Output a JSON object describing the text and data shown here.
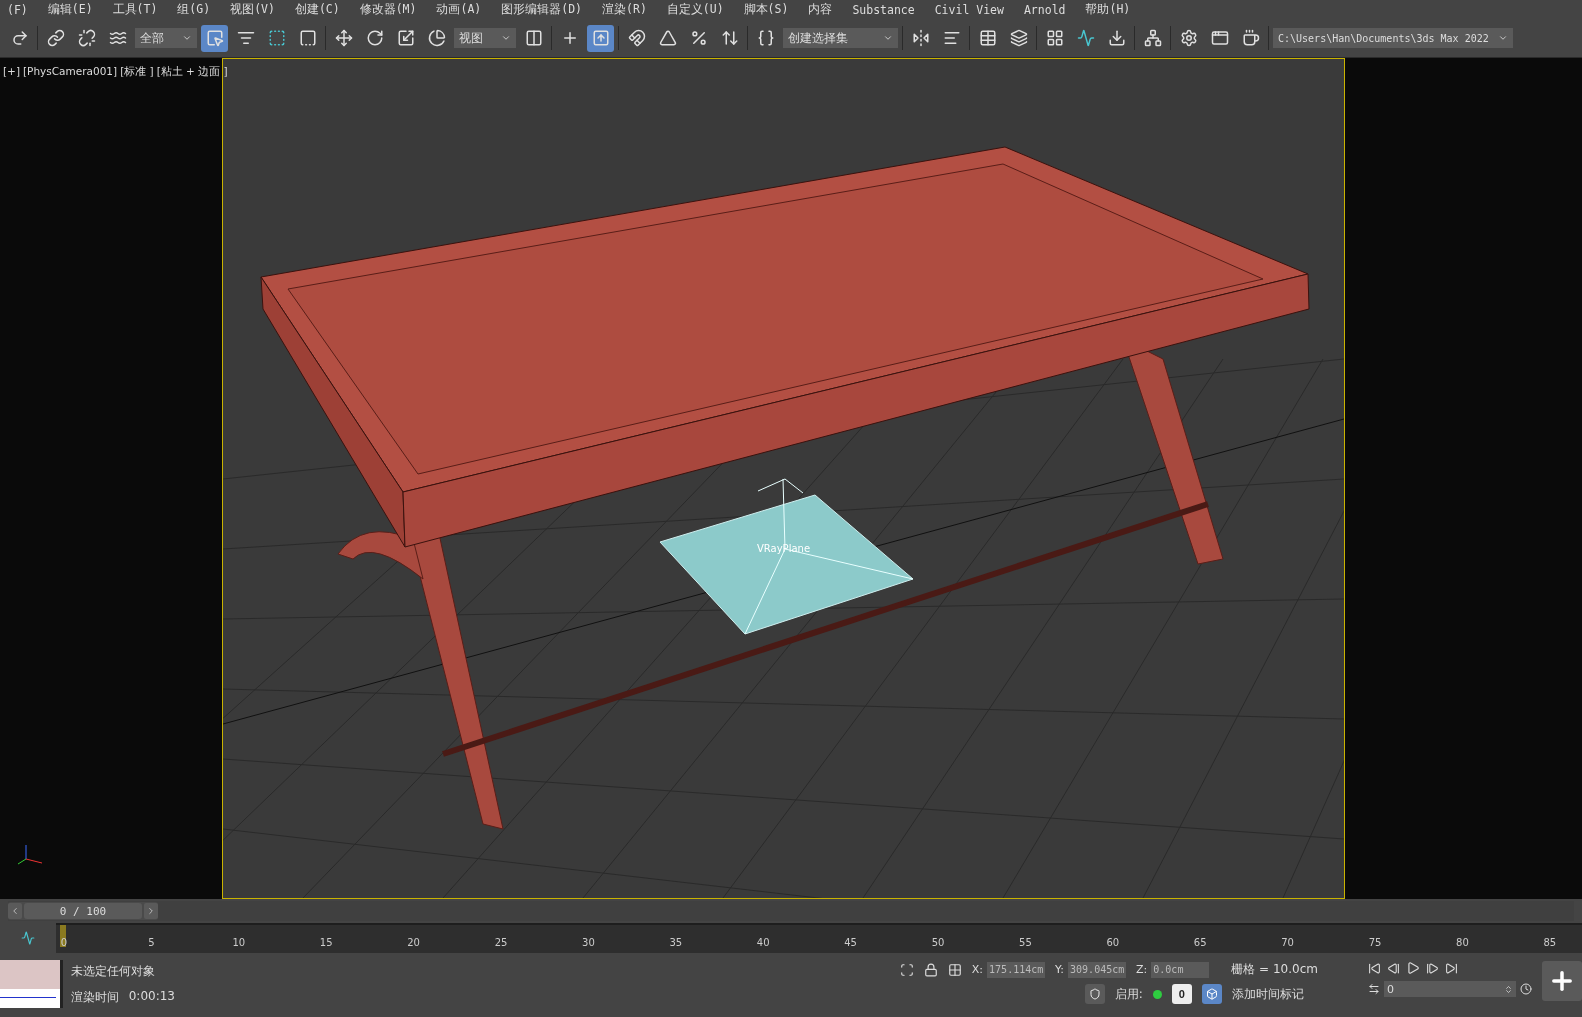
{
  "menu": [
    "(F)",
    "编辑(E)",
    "工具(T)",
    "组(G)",
    "视图(V)",
    "创建(C)",
    "修改器(M)",
    "动画(A)",
    "图形编辑器(D)",
    "渲染(R)",
    "自定义(U)",
    "脚本(S)",
    "内容",
    "Substance",
    "Civil View",
    "Arnold",
    "帮助(H)"
  ],
  "toolbar": [
    {
      "kind": "redo",
      "selected": false
    },
    {
      "kind": "sep"
    },
    {
      "kind": "link",
      "selected": false
    },
    {
      "kind": "unlink",
      "selected": false
    },
    {
      "kind": "bind",
      "selected": false
    },
    {
      "kind": "dropdown",
      "value": "全部",
      "wide": false
    },
    {
      "kind": "select",
      "selected": true
    },
    {
      "kind": "list",
      "selected": false
    },
    {
      "kind": "region",
      "selected": false
    },
    {
      "kind": "window",
      "selected": false
    },
    {
      "kind": "sep"
    },
    {
      "kind": "move",
      "selected": false
    },
    {
      "kind": "rotate",
      "selected": false
    },
    {
      "kind": "scale",
      "selected": false
    },
    {
      "kind": "place",
      "selected": false
    },
    {
      "kind": "dropdown",
      "value": "视图",
      "wide": false
    },
    {
      "kind": "pivot",
      "selected": false
    },
    {
      "kind": "sep"
    },
    {
      "kind": "cross",
      "selected": false
    },
    {
      "kind": "manip",
      "selected": true
    },
    {
      "kind": "sep"
    },
    {
      "kind": "snap",
      "selected": false
    },
    {
      "kind": "angle",
      "selected": false
    },
    {
      "kind": "percent",
      "selected": false
    },
    {
      "kind": "spinner",
      "selected": false
    },
    {
      "kind": "sep"
    },
    {
      "kind": "edit",
      "selected": false
    },
    {
      "kind": "dropdown",
      "value": "创建选择集",
      "wide": true
    },
    {
      "kind": "sep"
    },
    {
      "kind": "mirror",
      "selected": false
    },
    {
      "kind": "align",
      "selected": false
    },
    {
      "kind": "sep"
    },
    {
      "kind": "table",
      "selected": false
    },
    {
      "kind": "layers",
      "selected": false
    },
    {
      "kind": "sep"
    },
    {
      "kind": "grid",
      "selected": false
    },
    {
      "kind": "curve",
      "selected": false
    },
    {
      "kind": "download",
      "selected": false
    },
    {
      "kind": "sep"
    },
    {
      "kind": "schematic",
      "selected": false
    },
    {
      "kind": "sep"
    },
    {
      "kind": "render-setup",
      "selected": false
    },
    {
      "kind": "render-frame",
      "selected": false
    },
    {
      "kind": "render",
      "selected": false
    },
    {
      "kind": "sep"
    },
    {
      "kind": "path",
      "value": "C:\\Users\\Han\\Documents\\3ds Max 2022"
    }
  ],
  "viewport": {
    "labels": [
      "[+]",
      "[PhysCamera001]",
      "[标准 ]",
      "[粘土 + 边面 ]"
    ],
    "object_label": "VRayPlane"
  },
  "time_slider": {
    "value": "0 / 100",
    "level": 0
  },
  "track": {
    "ticks": [
      "0",
      "5",
      "10",
      "15",
      "20",
      "25",
      "30",
      "35",
      "40",
      "45",
      "50",
      "55",
      "60",
      "65",
      "70",
      "75",
      "80",
      "85"
    ]
  },
  "status": {
    "message": "未选定任何对象",
    "render_label": "渲染时间",
    "render_time": "0:00:13",
    "coords": [
      {
        "axis": "X:",
        "value": "175.114cm"
      },
      {
        "axis": "Y:",
        "value": "309.045cm"
      },
      {
        "axis": "Z:",
        "value": "0.0cm"
      }
    ],
    "grid": "栅格 = 10.0cm",
    "enable_label": "启用:",
    "enable_count": "0",
    "add_marker": "添加时间标记",
    "frame": "0"
  }
}
